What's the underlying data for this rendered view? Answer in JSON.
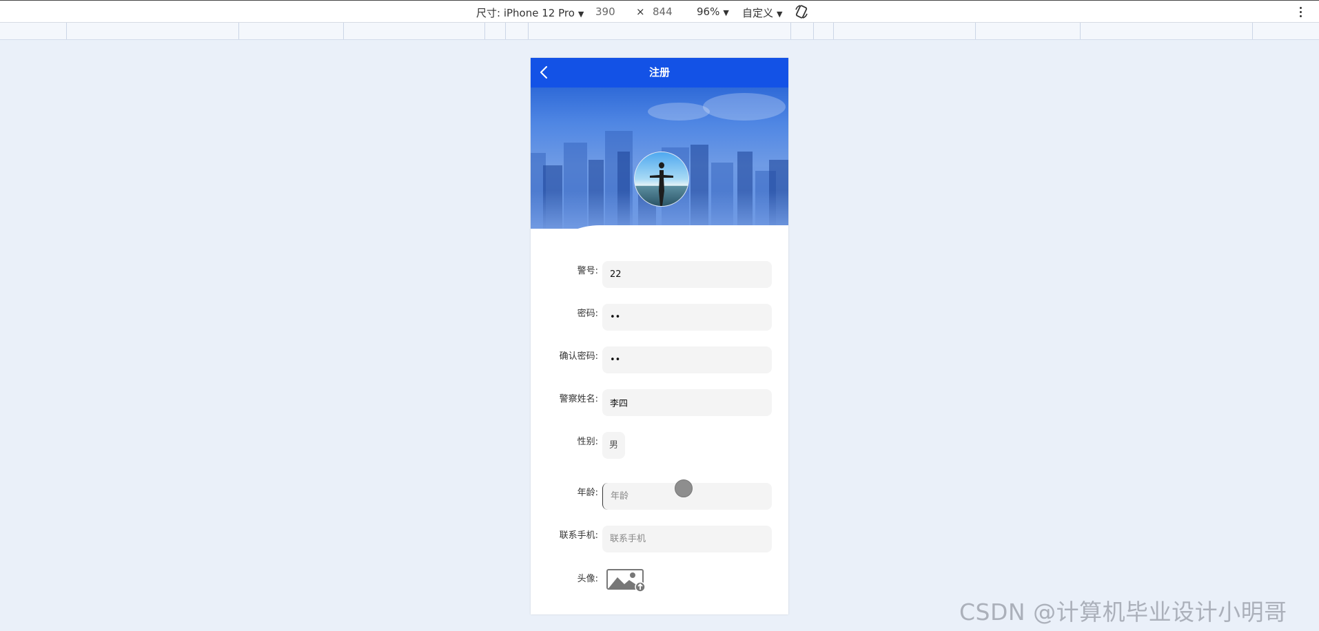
{
  "devtools": {
    "dimensions_label": "尺寸: iPhone 12 Pro",
    "width": "390",
    "times": "×",
    "height": "844",
    "zoom": "96%",
    "throttle": "自定义"
  },
  "navbar": {
    "title": "注册"
  },
  "form": {
    "badge_label": "警号:",
    "badge_value": "22",
    "password_label": "密码:",
    "password_value": "••",
    "confirm_label": "确认密码:",
    "confirm_value": "••",
    "name_label": "警察姓名:",
    "name_value": "李四",
    "gender_label": "性别:",
    "gender_value": "男",
    "age_label": "年龄:",
    "age_placeholder": "年龄",
    "phone_label": "联系手机:",
    "phone_placeholder": "联系手机",
    "avatar_label": "头像:"
  },
  "watermark": "CSDN @计算机毕业设计小明哥",
  "colors": {
    "primary": "#1352e6",
    "background": "#eaf0f9",
    "field": "#f4f4f4"
  }
}
